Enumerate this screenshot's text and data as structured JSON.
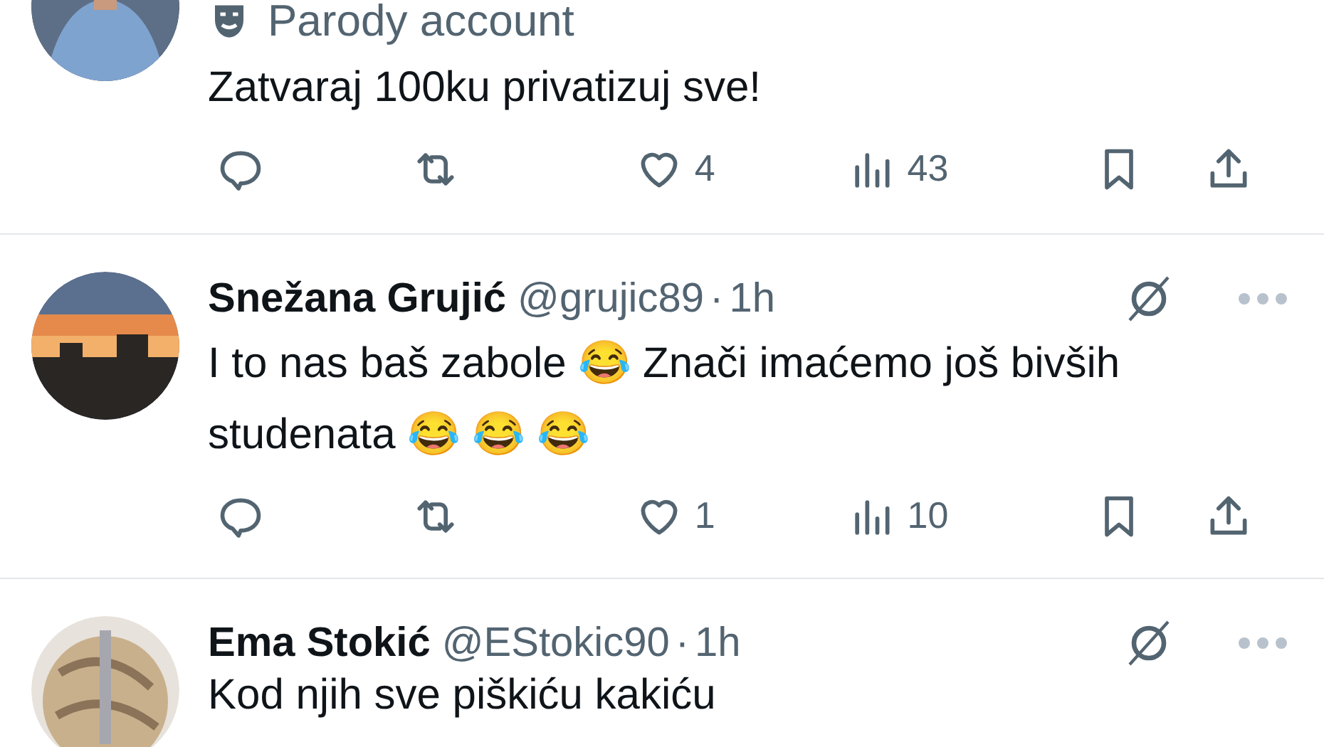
{
  "tweets": [
    {
      "parody_label": "Parody account",
      "text": "Zatvaraj 100ku privatizuj sve!",
      "likes": "4",
      "views": "43"
    },
    {
      "name": "Snežana Grujić",
      "handle": "@grujic89",
      "separator": "·",
      "time": "1h",
      "text": "I to nas baš zabole 😂 Znači imaćemo još bivših studenata 😂 😂 😂",
      "likes": "1",
      "views": "10"
    },
    {
      "name": "Ema Stokić",
      "handle": "@EStokic90",
      "separator": "·",
      "time": "1h",
      "text": "Kod njih sve piškiću kakiću"
    }
  ]
}
